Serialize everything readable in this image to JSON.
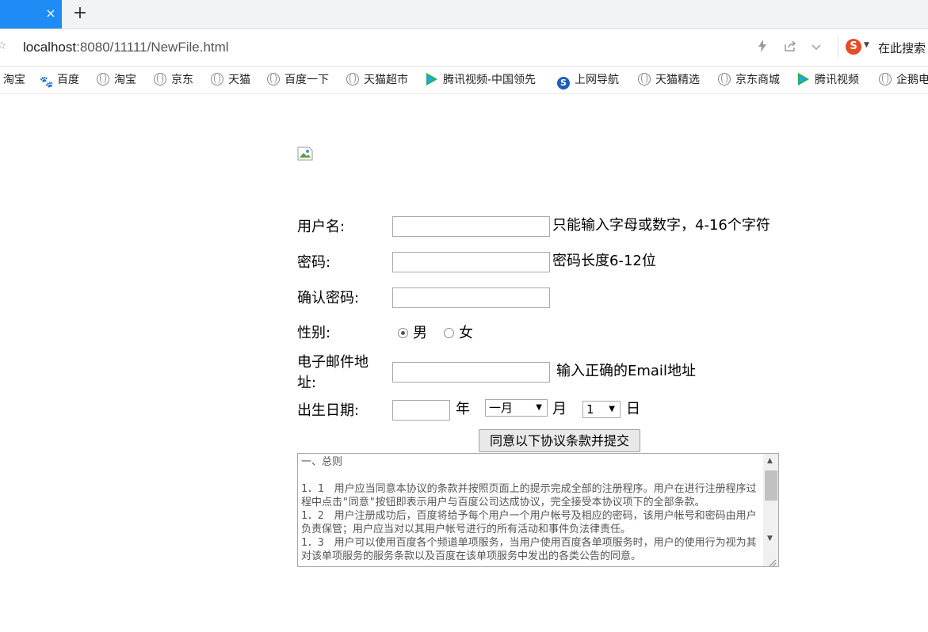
{
  "browser": {
    "tab_close": "×",
    "new_tab": "+",
    "url_host": "localhost",
    "url_path": ":8080/11111/NewFile.html",
    "search_placeholder": "在此搜索",
    "bookmarks": [
      "淘宝",
      "百度",
      "淘宝",
      "京东",
      "天猫",
      "百度一下",
      "天猫超市",
      "腾讯视频-中国领先",
      "上网导航",
      "天猫精选",
      "京东商城",
      "腾讯视频",
      "企鹅电"
    ]
  },
  "form": {
    "username_label": "用户名:",
    "username_hint": "只能输入字母或数字，4-16个字符",
    "password_label": "密码:",
    "password_hint": "密码长度6-12位",
    "confirm_label": "确认密码:",
    "gender_label": "性别:",
    "gender_male": "男",
    "gender_female": "女",
    "gender_selected": "男",
    "email_label_line1": "电子邮件地",
    "email_label_line2": "址:",
    "email_hint": "输入正确的Email地址",
    "birth_label": "出生日期:",
    "year_unit": "年",
    "month_value": "一月",
    "month_unit": "月",
    "day_value": "1",
    "day_unit": "日",
    "submit_label": "同意以下协议条款并提交",
    "agreement": "一、总则\n\n1．1　用户应当同意本协议的条款并按照页面上的提示完成全部的注册程序。用户在进行注册程序过程中点击\"同意\"按钮即表示用户与百度公司达成协议，完全接受本协议项下的全部条款。\n1．2　用户注册成功后，百度将给予每个用户一个用户帐号及相应的密码，该用户帐号和密码由用户负责保管；用户应当对以其用户帐号进行的所有活动和事件负法律责任。\n1．3　用户可以使用百度各个频道单项服务，当用户使用百度各单项服务时，用户的使用行为视为其对该单项服务的服务条款以及百度在该单项服务中发出的各类公告的同意。"
  }
}
